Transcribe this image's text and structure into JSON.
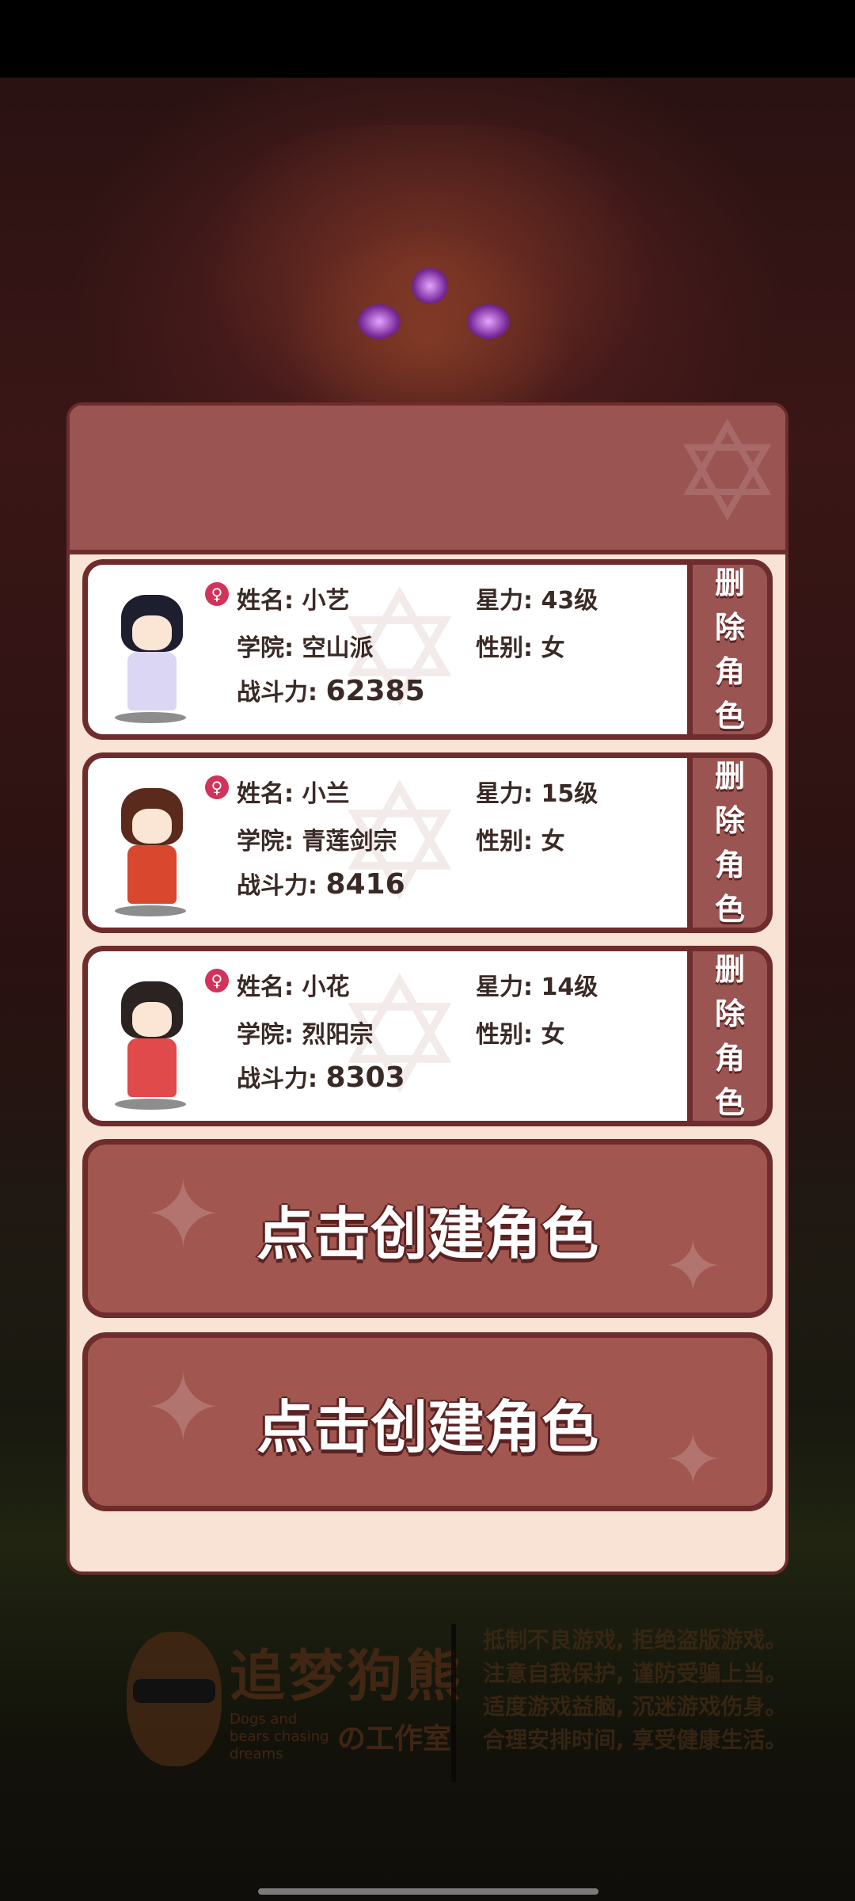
{
  "characters": [
    {
      "name_label": "姓名: 小艺",
      "level_label": "星力: 43级",
      "school_label": "学院: 空山派",
      "gender_label": "性别: 女",
      "power_prefix": "战斗力: ",
      "power_value": "62385",
      "delete_label": "删除角色",
      "hair_color": "#1d1f2e",
      "dress_color": "#dcd6f5"
    },
    {
      "name_label": "姓名: 小兰",
      "level_label": "星力: 15级",
      "school_label": "学院: 青莲剑宗",
      "gender_label": "性别: 女",
      "power_prefix": "战斗力: ",
      "power_value": "8416",
      "delete_label": "删除角色",
      "hair_color": "#5a2a1c",
      "dress_color": "#d9472e"
    },
    {
      "name_label": "姓名: 小花",
      "level_label": "星力: 14级",
      "school_label": "学院: 烈阳宗",
      "gender_label": "性别: 女",
      "power_prefix": "战斗力: ",
      "power_value": "8303",
      "delete_label": "删除角色",
      "hair_color": "#2a2322",
      "dress_color": "#e14a4a"
    }
  ],
  "create_buttons": [
    {
      "label": "点击创建角色"
    },
    {
      "label": "点击创建角色"
    }
  ],
  "footer": {
    "studio_name": "追梦狗熊",
    "studio_english": "Dogs and bears chasing dreams",
    "studio_suffix": "の工作室",
    "notice_lines": [
      "抵制不良游戏, 拒绝盗版游戏。",
      "注意自我保护, 谨防受骗上当。",
      "适度游戏益脑, 沉迷游戏伤身。",
      "合理安排时间, 享受健康生活。"
    ]
  },
  "icons": {
    "gender": "female-symbol-icon",
    "emblem": "hexagram-emblem-icon",
    "sparkle": "four-point-star-icon"
  },
  "colors": {
    "panel_bg": "#f8e3d4",
    "panel_header": "#9a5452",
    "border": "#6e2c2c",
    "button": "#a1564f",
    "female_badge": "#d0345a"
  }
}
